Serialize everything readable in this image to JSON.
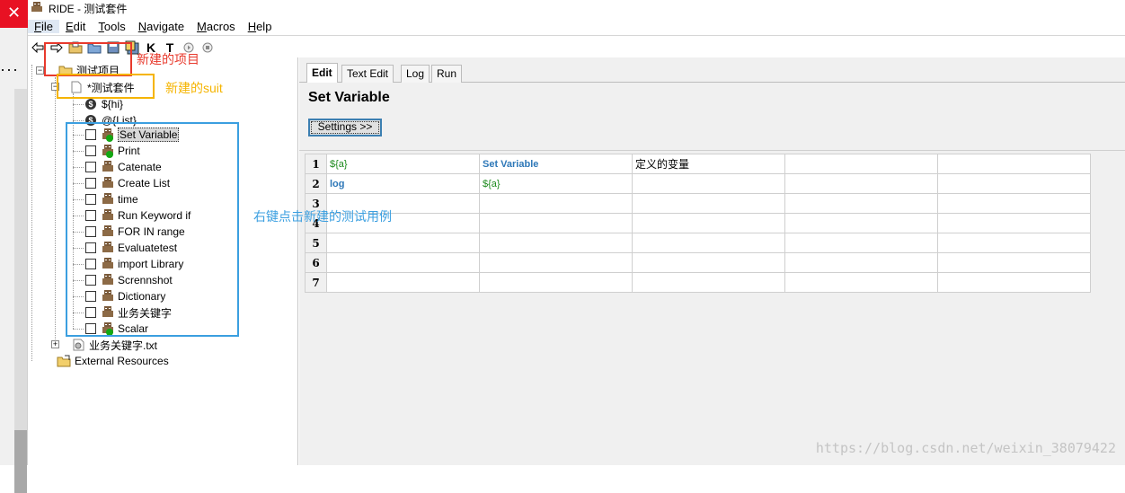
{
  "window": {
    "title": "RIDE - 测试套件",
    "close_glyph": "✕"
  },
  "menu": [
    {
      "key": "F",
      "rest": "ile"
    },
    {
      "key": "E",
      "rest": "dit"
    },
    {
      "key": "T",
      "rest": "ools"
    },
    {
      "key": "N",
      "rest": "avigate"
    },
    {
      "key": "M",
      "rest": "acros"
    },
    {
      "key": "H",
      "rest": "elp"
    }
  ],
  "toolbar": {
    "icons": [
      "back-arrow-icon",
      "forward-arrow-icon",
      "open-folder-icon",
      "open-directory-icon",
      "save-icon",
      "save-all-icon",
      "search-keyword-icon",
      "search-test-icon",
      "run-icon",
      "stop-icon"
    ],
    "keyword_search_glyph": "K",
    "test_search_glyph": "T"
  },
  "left_strip": {
    "dots": "···"
  },
  "tree": {
    "project": "测试项目",
    "suite": "*测试套件",
    "variables": [
      "${hi}",
      "@{List}"
    ],
    "var_icon_glyph": "$",
    "tests": [
      "Set Variable",
      "Print",
      "Catenate",
      "Create List",
      "time",
      "Run Keyword if",
      "FOR IN range",
      "Evaluatetest",
      "import Library",
      "Scrennshot",
      "Dictionary",
      "业务关键字",
      "Scalar"
    ],
    "resource_file": "业务关键字.txt",
    "external": "External Resources",
    "expander_plus": "+",
    "expander_minus": "−"
  },
  "editor": {
    "tabs": [
      "Edit",
      "Text Edit",
      "Log",
      "Run"
    ],
    "active_tab": "Edit",
    "keyword_title": "Set Variable",
    "settings_label": "Settings >>",
    "rows": [
      {
        "num": "1",
        "cells": [
          {
            "text": "${a}",
            "kind": "var"
          },
          {
            "text": "Set Variable",
            "kind": "kw"
          },
          {
            "text": "定义的变量",
            "kind": "plain"
          },
          {
            "text": "",
            "kind": "plain"
          },
          {
            "text": "",
            "kind": "plain"
          }
        ]
      },
      {
        "num": "2",
        "cells": [
          {
            "text": "log",
            "kind": "kw"
          },
          {
            "text": "${a}",
            "kind": "var"
          },
          {
            "text": "",
            "kind": "plain"
          },
          {
            "text": "",
            "kind": "plain"
          },
          {
            "text": "",
            "kind": "plain"
          }
        ]
      },
      {
        "num": "3",
        "cells": [
          {
            "text": "",
            "kind": "plain"
          },
          {
            "text": "",
            "kind": "plain"
          },
          {
            "text": "",
            "kind": "plain"
          },
          {
            "text": "",
            "kind": "plain"
          },
          {
            "text": "",
            "kind": "plain"
          }
        ]
      },
      {
        "num": "4",
        "cells": [
          {
            "text": "",
            "kind": "plain"
          },
          {
            "text": "",
            "kind": "plain"
          },
          {
            "text": "",
            "kind": "plain"
          },
          {
            "text": "",
            "kind": "plain"
          },
          {
            "text": "",
            "kind": "plain"
          }
        ]
      },
      {
        "num": "5",
        "cells": [
          {
            "text": "",
            "kind": "plain"
          },
          {
            "text": "",
            "kind": "plain"
          },
          {
            "text": "",
            "kind": "plain"
          },
          {
            "text": "",
            "kind": "plain"
          },
          {
            "text": "",
            "kind": "plain"
          }
        ]
      },
      {
        "num": "6",
        "cells": [
          {
            "text": "",
            "kind": "plain"
          },
          {
            "text": "",
            "kind": "plain"
          },
          {
            "text": "",
            "kind": "plain"
          },
          {
            "text": "",
            "kind": "plain"
          },
          {
            "text": "",
            "kind": "plain"
          }
        ]
      },
      {
        "num": "7",
        "cells": [
          {
            "text": "",
            "kind": "plain"
          },
          {
            "text": "",
            "kind": "plain"
          },
          {
            "text": "",
            "kind": "plain"
          },
          {
            "text": "",
            "kind": "plain"
          },
          {
            "text": "",
            "kind": "plain"
          }
        ]
      }
    ]
  },
  "annotations": {
    "project": {
      "text": "新建的项目",
      "color": "#e8392c"
    },
    "suite": {
      "text": "新建的suit",
      "color": "#f5b400"
    },
    "tests": {
      "text": "右键点击新建的测试用例",
      "color": "#3b9fe0"
    }
  },
  "watermark": "https://blog.csdn.net/weixin_38079422",
  "colors": {
    "var_green": "#1c8a1c",
    "keyword_blue": "#2e78b8",
    "close_red": "#e81123"
  }
}
